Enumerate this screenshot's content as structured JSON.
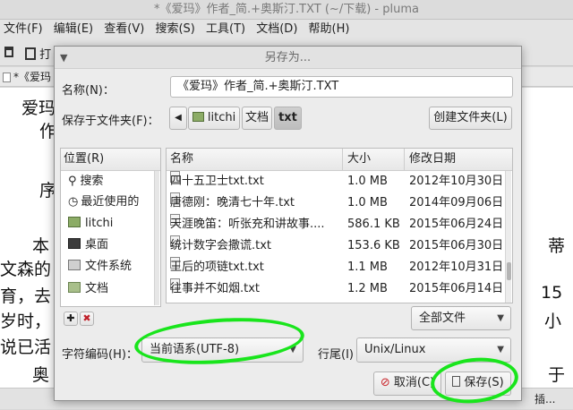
{
  "window": {
    "title": "*《爱玛》作者_简.+奥斯汀.TXT (~/下载) - pluma",
    "menu": [
      "文件(F)",
      "编辑(E)",
      "查看(V)",
      "搜索(S)",
      "工具(T)",
      "文档(D)",
      "帮助(H)"
    ],
    "toolbar_labels": [
      "打"
    ],
    "tab_label": "*《爱玛",
    "editor_lines": {
      "l1": "爱玛",
      "l2": "作",
      "l3": "序",
      "l4": "本",
      "l4r": "蒂",
      "l5": "文森的",
      "l5r": "",
      "l6": "育，去",
      "l6r": "15",
      "l7": "岁时，",
      "l7r": "小",
      "l8": "说已活",
      "l9": "奥",
      "l9r": "于"
    },
    "status_right": "插..."
  },
  "dialog": {
    "title": "另存为...",
    "name_label": "名称(N)：",
    "name_value": "《爱玛》作者_简.+奥斯汀.TXT",
    "save_in_label": "保存于文件夹(F)：",
    "breadcrumb": [
      "litchi",
      "文档",
      "txt"
    ],
    "create_folder": "创建文件夹(L)",
    "places_header": "位置(R)",
    "places": [
      {
        "label": "搜索",
        "icon": "search-icon"
      },
      {
        "label": "最近使用的",
        "icon": "clock-icon"
      },
      {
        "label": "litchi",
        "icon": "home-folder-icon"
      },
      {
        "label": "桌面",
        "icon": "desktop-icon"
      },
      {
        "label": "文件系统",
        "icon": "drive-icon"
      },
      {
        "label": "文档",
        "icon": "folder-icon"
      }
    ],
    "columns": {
      "name": "名称",
      "size": "大小",
      "date": "修改日期"
    },
    "files": [
      {
        "name": "四十五卫士txt.txt",
        "size": "1.0 MB",
        "date": "2012年10月30日"
      },
      {
        "name": "唐德刚：晚清七十年.txt",
        "size": "1.0 MB",
        "date": "2014年09月06日"
      },
      {
        "name": "天涯晚笛：听张充和讲故事....",
        "size": "586.1 KB",
        "date": "2015年06月24日"
      },
      {
        "name": "统计数字会撒谎.txt",
        "size": "153.6 KB",
        "date": "2015年06月30日"
      },
      {
        "name": "王后的项链txt.txt",
        "size": "1.1 MB",
        "date": "2012年10月31日"
      },
      {
        "name": "往事并不如烟.txt",
        "size": "1.2 MB",
        "date": "2015年06月14日"
      }
    ],
    "filter": "全部文件",
    "encoding_label": "字符编码(H)：",
    "encoding_value": "当前语系(UTF-8)",
    "line_end_label": "行尾(I)",
    "line_end_value": "Unix/Linux",
    "cancel": "取消(C)",
    "save": "保存(S)",
    "highlight_color": "#19e51c"
  }
}
